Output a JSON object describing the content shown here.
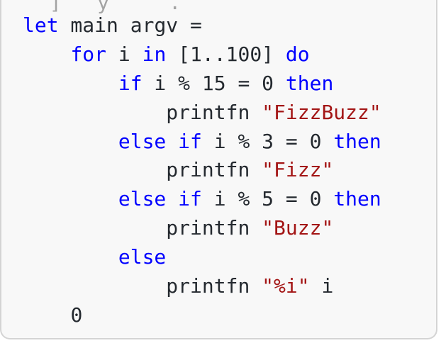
{
  "editor": {
    "partial_top_line": "  ]   y     .   ",
    "lines": [
      {
        "indent": "",
        "tokens": [
          {
            "text": "let",
            "kind": "kw"
          },
          {
            "text": " main argv =",
            "kind": "plain"
          }
        ]
      },
      {
        "indent": "    ",
        "tokens": [
          {
            "text": "for",
            "kind": "kw"
          },
          {
            "text": " i ",
            "kind": "plain"
          },
          {
            "text": "in",
            "kind": "kw"
          },
          {
            "text": " [1..100] ",
            "kind": "plain"
          },
          {
            "text": "do",
            "kind": "kw"
          }
        ]
      },
      {
        "indent": "        ",
        "tokens": [
          {
            "text": "if",
            "kind": "kw"
          },
          {
            "text": " i % 15 = 0 ",
            "kind": "plain"
          },
          {
            "text": "then",
            "kind": "kw"
          }
        ]
      },
      {
        "indent": "            ",
        "tokens": [
          {
            "text": "printfn ",
            "kind": "plain"
          },
          {
            "text": "\"FizzBuzz\"",
            "kind": "str"
          }
        ]
      },
      {
        "indent": "        ",
        "tokens": [
          {
            "text": "else",
            "kind": "kw"
          },
          {
            "text": " ",
            "kind": "plain"
          },
          {
            "text": "if",
            "kind": "kw"
          },
          {
            "text": " i % 3 = 0 ",
            "kind": "plain"
          },
          {
            "text": "then",
            "kind": "kw"
          }
        ]
      },
      {
        "indent": "            ",
        "tokens": [
          {
            "text": "printfn ",
            "kind": "plain"
          },
          {
            "text": "\"Fizz\"",
            "kind": "str"
          }
        ]
      },
      {
        "indent": "        ",
        "tokens": [
          {
            "text": "else",
            "kind": "kw"
          },
          {
            "text": " ",
            "kind": "plain"
          },
          {
            "text": "if",
            "kind": "kw"
          },
          {
            "text": " i % 5 = 0 ",
            "kind": "plain"
          },
          {
            "text": "then",
            "kind": "kw"
          }
        ]
      },
      {
        "indent": "            ",
        "tokens": [
          {
            "text": "printfn ",
            "kind": "plain"
          },
          {
            "text": "\"Buzz\"",
            "kind": "str"
          }
        ]
      },
      {
        "indent": "        ",
        "tokens": [
          {
            "text": "else",
            "kind": "kw"
          }
        ]
      },
      {
        "indent": "            ",
        "tokens": [
          {
            "text": "printfn ",
            "kind": "plain"
          },
          {
            "text": "\"%i\"",
            "kind": "str"
          },
          {
            "text": " i",
            "kind": "plain"
          }
        ]
      },
      {
        "indent": "    ",
        "tokens": [
          {
            "text": "0",
            "kind": "plain"
          }
        ]
      }
    ]
  },
  "colors": {
    "keyword": "#0000ff",
    "string": "#a31515",
    "plain": "#24292f",
    "background": "#f8f8f8",
    "border": "#d4d4d4"
  }
}
